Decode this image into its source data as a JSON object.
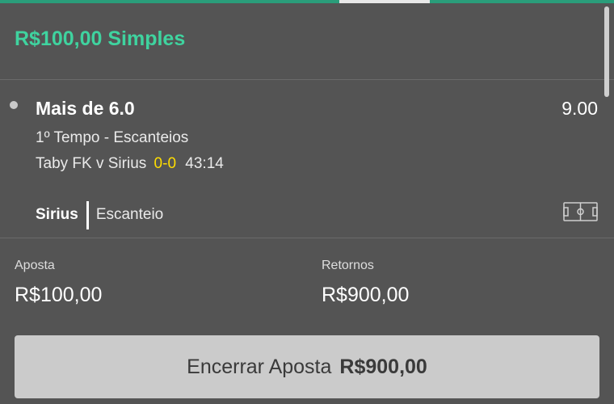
{
  "bet": {
    "title": "R$100,00 Simples"
  },
  "selection": {
    "name": "Mais de 6.0",
    "odds": "9.00",
    "market": "1º Tempo - Escanteios",
    "event": {
      "teams": "Taby FK v Sirius",
      "score": "0-0",
      "clock": "43:14"
    },
    "last_event": {
      "team": "Sirius",
      "type": "Escanteio"
    },
    "pitch_icon": "football-pitch-icon"
  },
  "stake": {
    "label": "Aposta",
    "value": "R$100,00"
  },
  "returns": {
    "label": "Retornos",
    "value": "R$900,00"
  },
  "cashout": {
    "label": "Encerrar Aposta",
    "amount": "R$900,00"
  },
  "colors": {
    "background": "#545454",
    "accent_green": "#3fd39f",
    "score_yellow": "#ffdd00",
    "button_bg": "#cbcbcb"
  }
}
